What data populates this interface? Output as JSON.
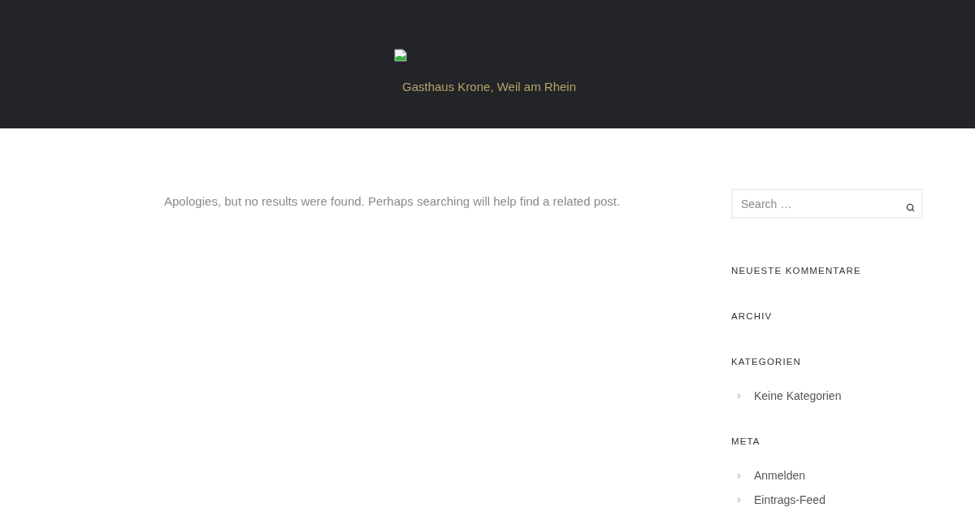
{
  "header": {
    "site_title": "Gasthaus Krone, Weil am Rhein"
  },
  "content": {
    "message": "Apologies, but no results were found. Perhaps searching will help find a related post."
  },
  "sidebar": {
    "search": {
      "placeholder": "Search …"
    },
    "widgets": [
      {
        "title": "NEUESTE KOMMENTARE"
      },
      {
        "title": "ARCHIV"
      },
      {
        "title": "KATEGORIEN",
        "items": [
          "Keine Kategorien"
        ]
      },
      {
        "title": "META",
        "items": [
          "Anmelden",
          "Eintrags-Feed"
        ]
      }
    ]
  }
}
